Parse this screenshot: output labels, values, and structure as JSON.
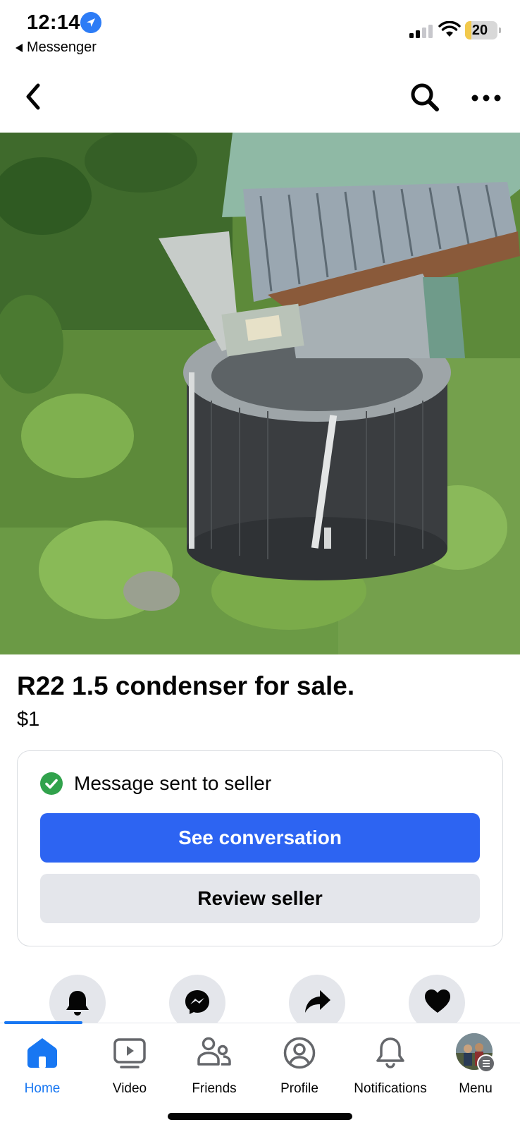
{
  "status_bar": {
    "time": "12:14",
    "back_app": "Messenger",
    "battery": "20",
    "battery_level_percent": 20,
    "icons": [
      "location-arrow-icon",
      "cellular-signal-icon",
      "wifi-icon",
      "battery-icon"
    ]
  },
  "header": {
    "icons": [
      "back-chevron-icon",
      "search-icon",
      "more-icon"
    ]
  },
  "listing": {
    "title": "R22 1.5 condenser for sale.",
    "price": "$1"
  },
  "message_card": {
    "status": "Message sent to seller",
    "primary_button": "See conversation",
    "secondary_button": "Review seller"
  },
  "actions": [
    "bell-icon",
    "messenger-icon",
    "share-icon",
    "heart-icon"
  ],
  "tabs": [
    {
      "label": "Home",
      "icon": "home-icon",
      "active": true
    },
    {
      "label": "Video",
      "icon": "video-icon",
      "active": false
    },
    {
      "label": "Friends",
      "icon": "friends-icon",
      "active": false
    },
    {
      "label": "Profile",
      "icon": "profile-icon",
      "active": false
    },
    {
      "label": "Notifications",
      "icon": "notifications-icon",
      "active": false
    },
    {
      "label": "Menu",
      "icon": "menu-avatar-icon",
      "active": false
    }
  ],
  "colors": {
    "accent": "#1877f2",
    "primary_button": "#2d64f2",
    "secondary_button": "#e4e6eb",
    "success": "#31a24c",
    "battery_fill": "#f2c94c"
  }
}
